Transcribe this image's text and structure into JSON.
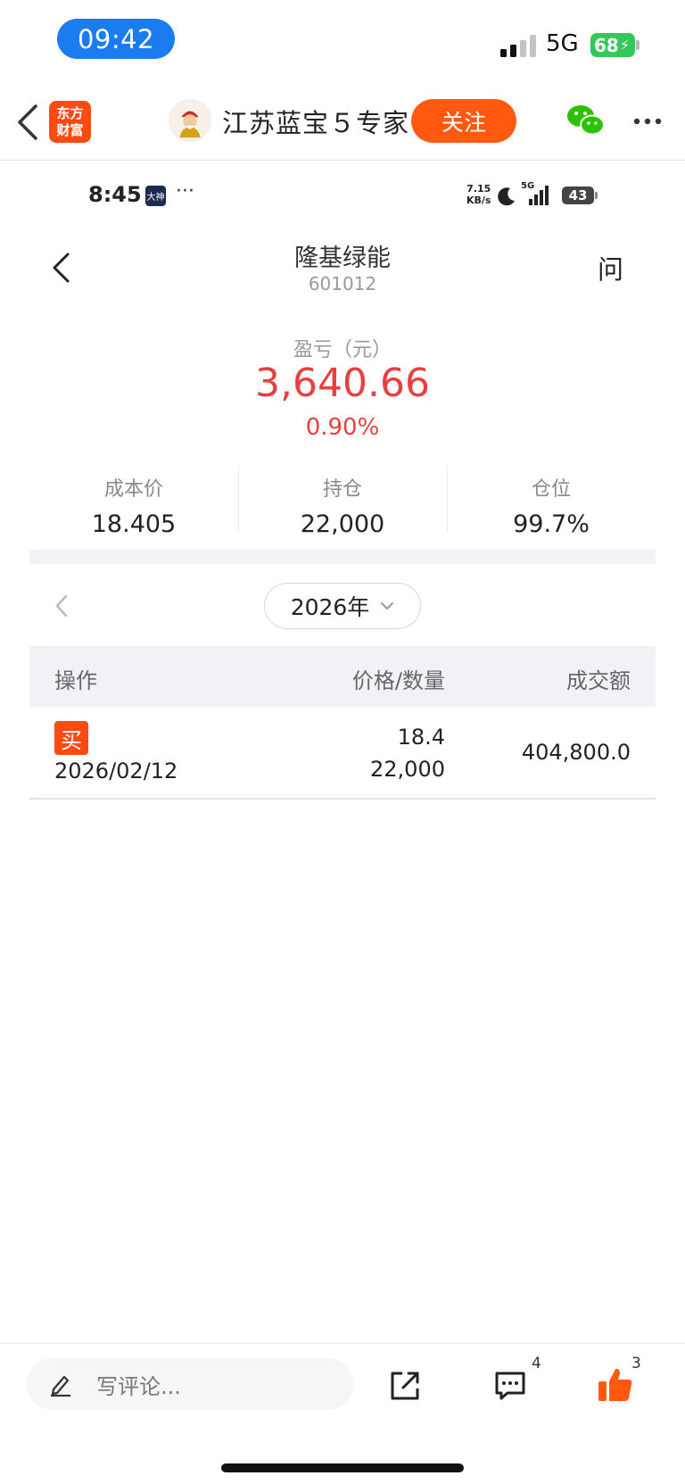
{
  "status_bar": {
    "time": "09:42",
    "network": "5G",
    "battery": "68"
  },
  "header": {
    "brand_logo_line1": "东方",
    "brand_logo_line2": "财富",
    "account_name": "江苏蓝宝５专家",
    "follow_label": "关注"
  },
  "inner_status": {
    "time": "8:45",
    "badge": "大神",
    "dots": "···",
    "speed_value": "7.15",
    "speed_unit": "KB/s",
    "network": "5G",
    "battery": "43"
  },
  "stock": {
    "name": "隆基绿能",
    "code": "601012",
    "ask_label": "问"
  },
  "pnl": {
    "label": "盈亏（元）",
    "value": "3,640.66",
    "percent": "0.90%",
    "color": "#e8403e"
  },
  "stats": [
    {
      "label": "成本价",
      "value": "18.405"
    },
    {
      "label": "持仓",
      "value": "22,000"
    },
    {
      "label": "仓位",
      "value": "99.7%"
    }
  ],
  "year_selector": {
    "value": "2026年"
  },
  "table": {
    "headers": [
      "操作",
      "价格/数量",
      "成交额"
    ],
    "rows": [
      {
        "action": "买",
        "date": "2026/02/12",
        "price": "18.4",
        "quantity": "22,000",
        "amount": "404,800.0"
      }
    ]
  },
  "bottom_bar": {
    "comment_placeholder": "写评论...",
    "comment_count": "4",
    "like_count": "3"
  },
  "colors": {
    "accent": "#ff5a10",
    "time_pill": "#1a7cf0",
    "battery": "#34c759"
  }
}
